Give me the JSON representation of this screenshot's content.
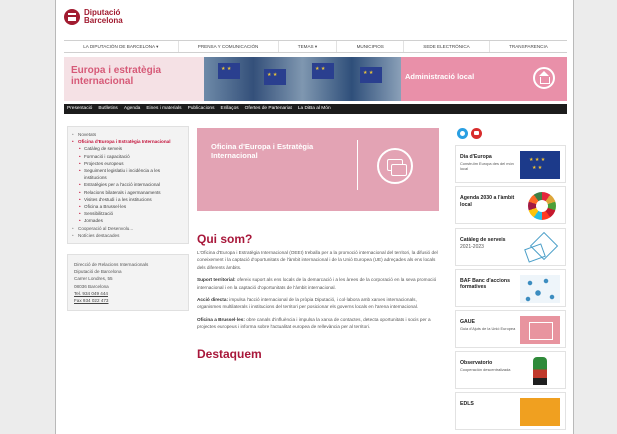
{
  "header": {
    "logo_line1": "Diputació",
    "logo_line2": "Barcelona"
  },
  "topnav": [
    "LA DIPUTACIÓN DE BARCELONA ▾",
    "PRENSA Y COMUNICACIÓN",
    "TEMAS ▾",
    "MUNICIPIOS",
    "SEDE ELECTRÓNICA",
    "TRANSPARENCIA"
  ],
  "banner": {
    "title": "Europa i estratègia internacional",
    "admin_label": "Administració local"
  },
  "secnav": [
    "Presentació",
    "Butlletins",
    "Agenda",
    "Eines i materials",
    "Publicacions",
    "Enllaços",
    "Ofertes de Partenariat",
    "La DiBa al Món"
  ],
  "sidebar": {
    "items": [
      {
        "label": "Novetats",
        "active": false
      },
      {
        "label": "Oficina d'Europa i Estratègia Internacional",
        "active": true
      }
    ],
    "subitems": [
      "Catàleg de serveis",
      "Formació i capacitació",
      "Projectes europeus",
      "Seguiment legislatiu i incidència a les institucions",
      "Estratègies per a l'acció internacional",
      "Relacions bilaterals i agermanaments",
      "Visites d'estudi i a les institucions",
      "Oficina a Brussel·les",
      "Sensibilització",
      "Jornades"
    ],
    "bottom_items": [
      "Cooperació al Desenvolu...",
      "Notícies destacades"
    ],
    "address": {
      "line1": "Direcció de Relacions Internacionals",
      "line2": "Diputació de Barcelona",
      "line3": "Carrer Londres, 55",
      "line4": "08036 Barcelona",
      "tel": "Tel. 934 049 444",
      "fax": "Fax 934 022 473"
    }
  },
  "main": {
    "hero_title": "Oficina d'Europa i Estratègia Internacional",
    "heading": "Qui som?",
    "intro": "L'Oficina d'Europa i Estratègia Internacional (OEEI) treballa per a la promoció internacional del territori, la difusió del coneixement i la captació d'oportunitats de l'àmbit internacional i de la Unió Europea (UE) adreçades als ens locals dels diferents àmbits.",
    "p1_bold": "Suport territorial:",
    "p1_text": " ofereix suport als ens locals de la demarcació i a les àrees de la corporació en la seva promoció internacional i en la captació d'oportunitats de l'àmbit internacional.",
    "p2_bold": "Acció directa:",
    "p2_text": " impulsa l'acció internacional de la pròpia Diputació, i col·labora amb xarxes internacionals, organismes multilaterals i institucions del territori per posicionar els governs locals en l'arena internacional.",
    "p3_bold": "Oficina a Brussel·les:",
    "p3_text": " obre canals d'influència i impulsa la xarxa de contactes, detecta oportunitats i socis per a projectes europeus i informa sobre l'actualitat europea de rellevància per al territori.",
    "heading2": "Destaquem"
  },
  "rightcol": {
    "cards": [
      {
        "title": "Dia d'Europa",
        "sub": "Construïm Europa des del món local",
        "icon": "eu-flag-icon"
      },
      {
        "title": "Agenda 2030 a l'àmbit local",
        "sub": "",
        "icon": "sdg-wheel-icon"
      },
      {
        "title": "Catàleg de serveis",
        "sub": "2021-2023",
        "icon": "catalog-icon"
      },
      {
        "title": "BAF Banc d'accions formatives",
        "sub": "",
        "icon": "network-icon"
      },
      {
        "title": "GAUE",
        "sub": "Guia d'Ajuts de la Unió Europea",
        "icon": "book-icon"
      },
      {
        "title": "Observatorio",
        "sub": "Cooperación descentralizada",
        "icon": "figure-icon"
      },
      {
        "title": "EDLS",
        "sub": "",
        "icon": "edls-icon"
      }
    ]
  }
}
